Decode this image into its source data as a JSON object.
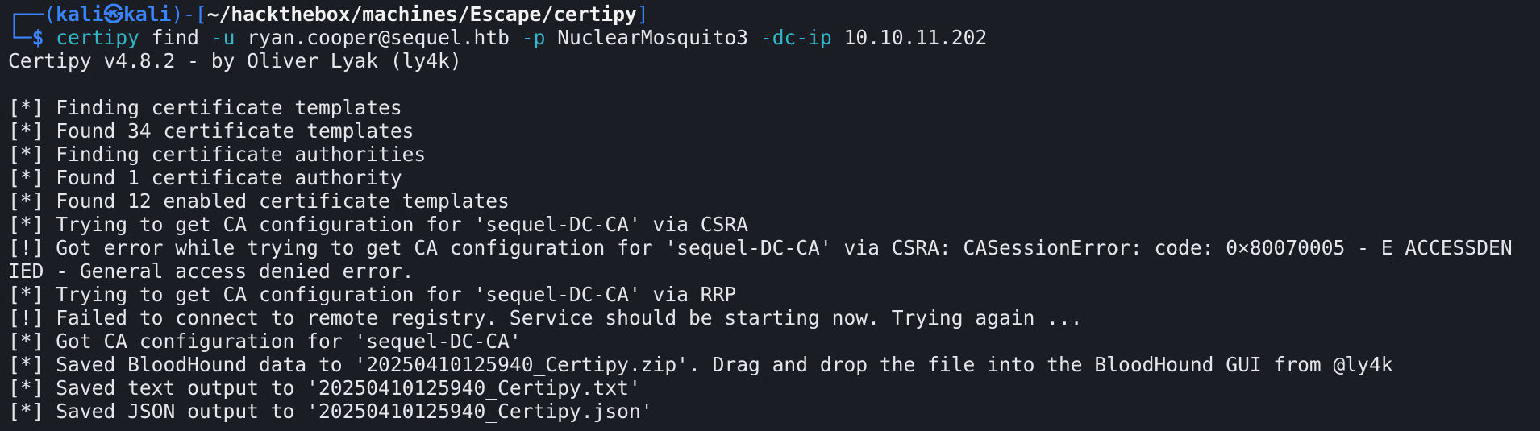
{
  "prompt": {
    "corner_top": "┌──(",
    "user": "kali",
    "skull": "㉿",
    "host": "kali",
    "mid": ")-[",
    "path": "~/hackthebox/machines/Escape/certipy",
    "close": "]",
    "corner_bottom": "└─",
    "dollar": "$"
  },
  "command": {
    "program": "certipy",
    "subcommand": "find",
    "flag_user": "-u",
    "user_value": "ryan.cooper@sequel.htb",
    "flag_pass": "-p",
    "pass_value": "NuclearMosquito3",
    "flag_dc": "-dc-ip",
    "dc_value": "10.10.11.202"
  },
  "output": [
    "Certipy v4.8.2 - by Oliver Lyak (ly4k)",
    "",
    "[*] Finding certificate templates",
    "[*] Found 34 certificate templates",
    "[*] Finding certificate authorities",
    "[*] Found 1 certificate authority",
    "[*] Found 12 enabled certificate templates",
    "[*] Trying to get CA configuration for 'sequel-DC-CA' via CSRA",
    "[!] Got error while trying to get CA configuration for 'sequel-DC-CA' via CSRA: CASessionError: code: 0×80070005 - E_ACCESSDEN",
    "IED - General access denied error.",
    "[*] Trying to get CA configuration for 'sequel-DC-CA' via RRP",
    "[!] Failed to connect to remote registry. Service should be starting now. Trying again ...",
    "[*] Got CA configuration for 'sequel-DC-CA'",
    "[*] Saved BloodHound data to '20250410125940_Certipy.zip'. Drag and drop the file into the BloodHound GUI from @ly4k",
    "[*] Saved text output to '20250410125940_Certipy.txt'",
    "[*] Saved JSON output to '20250410125940_Certipy.json'"
  ],
  "colors": {
    "background": "#1a1d24",
    "prompt_blue": "#3a84ff",
    "flag_cyan": "#2fb6c8",
    "text": "#e6e6ea"
  }
}
